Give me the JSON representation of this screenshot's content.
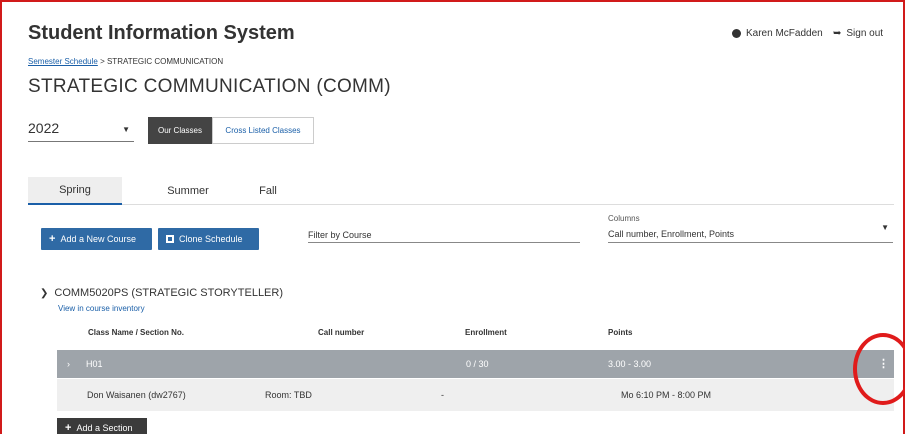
{
  "header": {
    "app_title": "Student Information System",
    "user_name": "Karen McFadden",
    "sign_out": "Sign out",
    "user_icon": "user-circle-icon",
    "signout_icon": "sign-out-icon"
  },
  "breadcrumb": {
    "link": "Semester Schedule",
    "separator": ">",
    "current": "STRATEGIC COMMUNICATION"
  },
  "page_title": "STRATEGIC COMMUNICATION (COMM)",
  "year_select": {
    "value": "2022"
  },
  "class_toggle": {
    "our": "Our Classes",
    "cross": "Cross Listed Classes",
    "selected": "Our Classes"
  },
  "tabs": [
    {
      "label": "Spring",
      "active": true
    },
    {
      "label": "Summer",
      "active": false
    },
    {
      "label": "Fall",
      "active": false
    }
  ],
  "toolbar": {
    "add_course": "Add a New Course",
    "clone": "Clone Schedule",
    "filter_placeholder": "Filter by Course",
    "columns_label": "Columns",
    "columns_value": "Call number, Enrollment, Points"
  },
  "course": {
    "title": "COMM5020PS (STRATEGIC STORYTELLER)",
    "inventory_link": "View in course inventory",
    "columns": [
      "Class Name / Section No.",
      "Call number",
      "Enrollment",
      "Points"
    ],
    "section": {
      "name": "H01",
      "call_number": "",
      "enrollment": "0 / 30",
      "points": "3.00  -  3.00"
    },
    "detail": {
      "instructor": "Don Waisanen (dw2767)",
      "room": "Room: TBD",
      "dash": "-",
      "schedule": "Mo 6:10 PM - 8:00 PM"
    },
    "add_section": "Add a Section"
  },
  "colors": {
    "accent": "#2f6aa5",
    "section_row": "#9ea4aa",
    "annotation": "#e01b1b",
    "frame": "#d11a1a"
  }
}
